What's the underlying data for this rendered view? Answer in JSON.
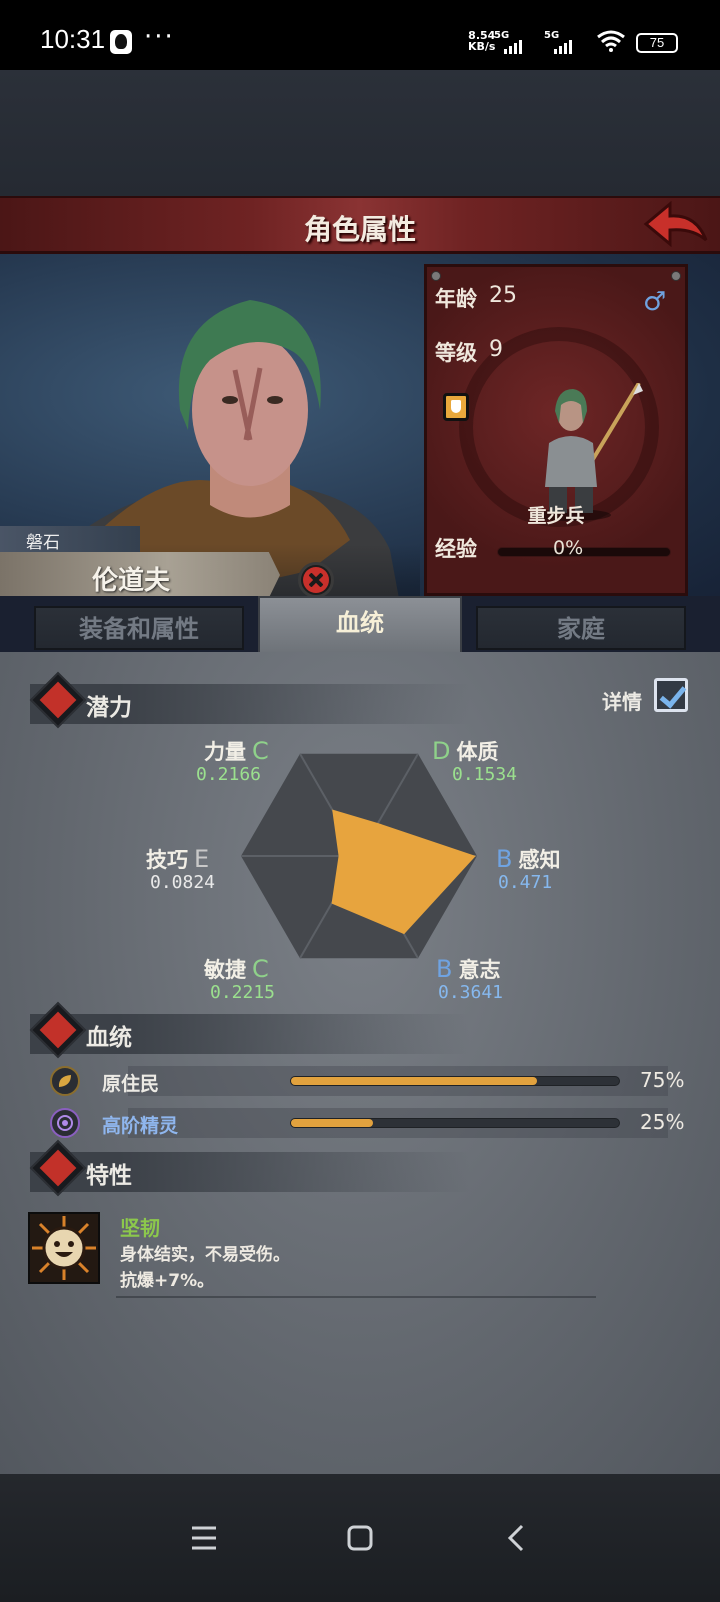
{
  "status_bar": {
    "time": "10:31",
    "more": "···",
    "net_speed_value": "8.54",
    "net_speed_unit": "KB/s",
    "sim1": "5G",
    "sim2": "5G",
    "battery": "75"
  },
  "header": {
    "title": "角色属性"
  },
  "character": {
    "clan": "磐石",
    "name": "伦道夫",
    "age_label": "年龄",
    "age": "25",
    "gender": "♂",
    "level_label": "等级",
    "level": "9",
    "unit_type": "重步兵",
    "xp_label": "经验",
    "xp_percent": "0%",
    "xp_fraction": 0
  },
  "tabs": [
    {
      "label": "装备和属性",
      "active": false
    },
    {
      "label": "血统",
      "active": true
    },
    {
      "label": "家庭",
      "active": false
    }
  ],
  "potential": {
    "section_label": "潜力",
    "detail_label": "详情",
    "detail_checked": true,
    "attributes": {
      "strength": {
        "name": "力量",
        "grade": "C",
        "value": "0.2166"
      },
      "constitution": {
        "name": "体质",
        "grade": "D",
        "value": "0.1534"
      },
      "skill": {
        "name": "技巧",
        "grade": "E",
        "value": "0.0824"
      },
      "perception": {
        "name": "感知",
        "grade": "B",
        "value": "0.471"
      },
      "agility": {
        "name": "敏捷",
        "grade": "C",
        "value": "0.2215"
      },
      "will": {
        "name": "意志",
        "grade": "B",
        "value": "0.3641"
      }
    },
    "grade_colors": {
      "B": "#6fa3e2",
      "C": "#8fd18a",
      "D": "#8fd18a",
      "E": "#c9c9c9"
    },
    "value_colors": {
      "green": "#9be08e",
      "blue": "#86b8ee",
      "white": "#e9e9e9"
    },
    "radar_fill": "#e7a43e"
  },
  "bloodline": {
    "section_label": "血统",
    "items": [
      {
        "name": "原住民",
        "percent": "75%",
        "fraction": 0.75,
        "color": "#eceae4",
        "icon": "leaf-icon"
      },
      {
        "name": "高阶精灵",
        "percent": "25%",
        "fraction": 0.25,
        "color": "#8fb6ee",
        "icon": "elf-eye-icon"
      }
    ]
  },
  "traits": {
    "section_label": "特性",
    "items": [
      {
        "name": "坚韧",
        "desc_line1": "身体结实，不易受伤。",
        "desc_line2": "抗爆+7%。",
        "icon": "smiley-face-icon"
      }
    ]
  }
}
